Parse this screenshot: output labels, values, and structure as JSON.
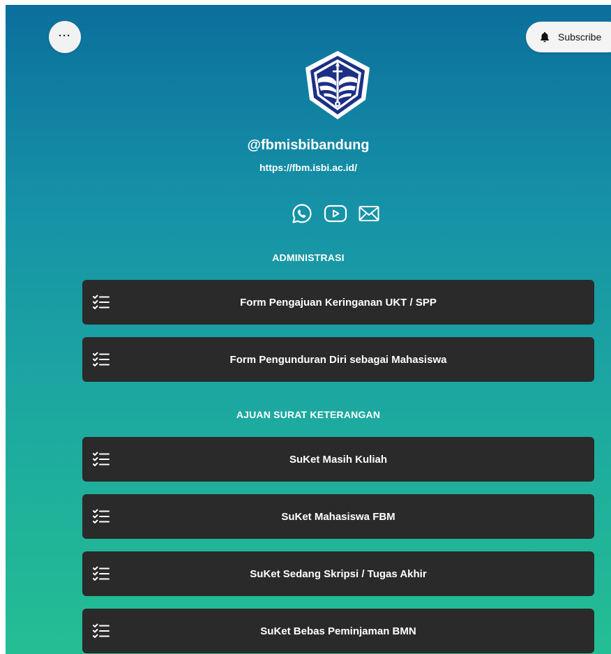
{
  "header": {
    "more_label": "···",
    "subscribe_label": "Subscribe"
  },
  "profile": {
    "handle": "@fbmisbibandung",
    "website": "https://fbm.isbi.ac.id/"
  },
  "socials": [
    {
      "icon": "whatsapp-icon"
    },
    {
      "icon": "youtube-icon"
    },
    {
      "icon": "email-icon"
    }
  ],
  "sections": {
    "administrasi": {
      "title": "ADMINISTRASI",
      "links": [
        {
          "label": "Form Pengajuan Keringanan UKT / SPP"
        },
        {
          "label": "Form Pengunduran Diri sebagai Mahasiswa"
        }
      ]
    },
    "ajuan": {
      "title": "AJUAN SURAT KETERANGAN",
      "links": [
        {
          "label": "SuKet Masih Kuliah"
        },
        {
          "label": "SuKet Mahasiswa FBM"
        },
        {
          "label": "SuKet Sedang Skripsi / Tugas Akhir"
        },
        {
          "label": "SuKet Bebas Peminjaman BMN"
        }
      ]
    }
  },
  "colors": {
    "gradient_top": "#0b6f9c",
    "gradient_bottom": "#24be93",
    "card_bg": "#2a2a2a",
    "text": "#ffffff"
  }
}
